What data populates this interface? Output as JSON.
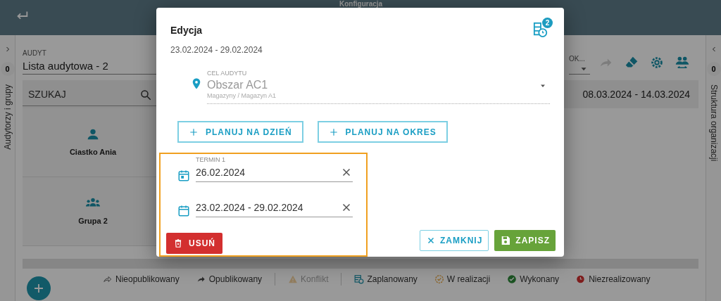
{
  "header": {
    "title": "Konfiguracja"
  },
  "left_panel": {
    "count": "0",
    "label": "Audytorzy i grupy"
  },
  "audit": {
    "label": "AUDYT",
    "value": "Lista audytowa - 2"
  },
  "period": {
    "label": "OK..."
  },
  "toolbar": [
    {
      "kind": "publish",
      "disabled": true
    },
    {
      "kind": "eraser",
      "disabled": false
    },
    {
      "kind": "settings",
      "disabled": false
    },
    {
      "kind": "people",
      "disabled": false
    }
  ],
  "search": {
    "placeholder": "SZUKAJ"
  },
  "date_range": "08.03.2024 - 14.03.2024",
  "rows": [
    {
      "kind": "person",
      "name": "Ciastko Ania"
    },
    {
      "kind": "group",
      "name": "Grupa 2"
    }
  ],
  "right_panel": {
    "count": "0",
    "label": "Struktura organizacji"
  },
  "legend_groups": [
    {
      "items": [
        {
          "kind": "unpublished",
          "label": "Nieopublikowany",
          "disabled": false
        },
        {
          "kind": "published",
          "label": "Opublikowany",
          "disabled": false
        }
      ]
    },
    {
      "items": [
        {
          "kind": "conflict",
          "label": "Konflikt",
          "disabled": true
        }
      ]
    },
    {
      "items": [
        {
          "kind": "planned",
          "label": "Zaplanowany",
          "disabled": false
        },
        {
          "kind": "in_progress",
          "label": "W realizacji",
          "disabled": false
        },
        {
          "kind": "done",
          "label": "Wykonany",
          "disabled": false
        },
        {
          "kind": "not_done",
          "label": "Niezrealizowany",
          "disabled": false
        }
      ]
    }
  ],
  "dialog": {
    "title": "Edycja",
    "subtitle": "23.02.2024 - 29.02.2024",
    "badge": "2",
    "target": {
      "disabled": true,
      "label": "CEL AUDYTU",
      "value": "Obszar AC1",
      "path": "Magazyny / Magazyn A1"
    },
    "plan_buttons": [
      "PLANUJ NA DZIEŃ",
      "PLANUJ NA OKRES"
    ],
    "terms": [
      {
        "kind": "day",
        "label": "TERMIN 1",
        "value": "26.02.2024"
      },
      {
        "kind": "range",
        "value": "23.02.2024 - 29.02.2024"
      }
    ],
    "delete_button": "USUŃ",
    "close_button": "ZAMKNIJ",
    "save_button": "ZAPISZ"
  }
}
